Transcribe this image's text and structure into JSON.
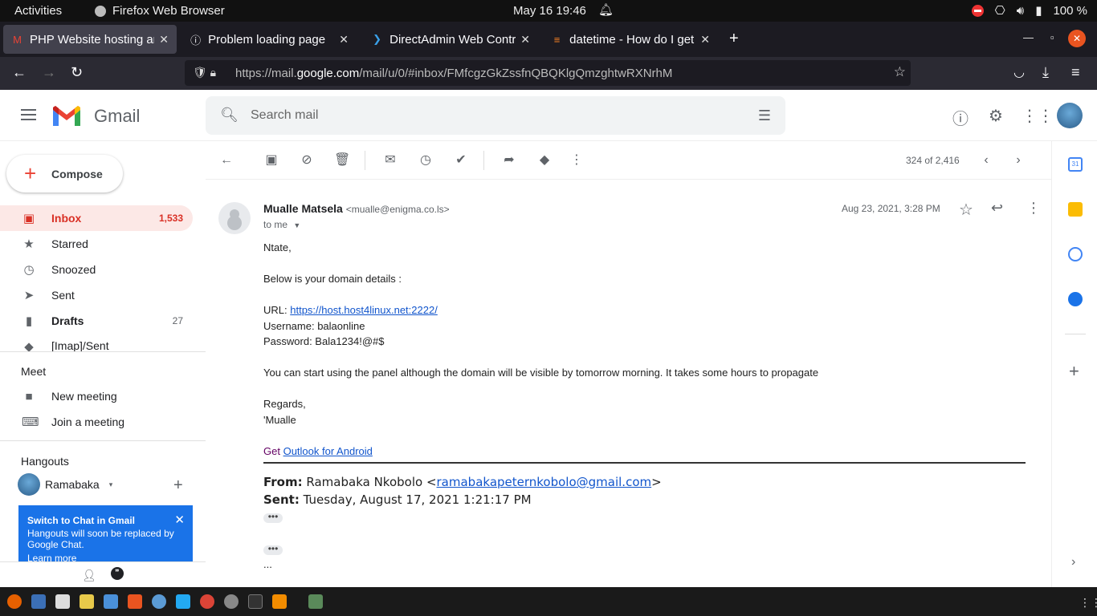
{
  "system": {
    "activities": "Activities",
    "app_name": "Firefox Web Browser",
    "datetime": "May 16  19:46",
    "battery": "100 %"
  },
  "browser": {
    "tabs": [
      {
        "label": "PHP Website hosting and",
        "active": true
      },
      {
        "label": "Problem loading page",
        "active": false
      },
      {
        "label": "DirectAdmin Web Contro",
        "active": false
      },
      {
        "label": "datetime - How do I get t",
        "active": false
      }
    ],
    "url_prefix": "https://mail.",
    "url_domain": "google.com",
    "url_path": "/mail/u/0/#inbox/FMfcgzGkZssfnQBQKlgQmzghtwRXNrhM"
  },
  "gmail": {
    "brand": "Gmail",
    "search_placeholder": "Search mail",
    "compose": "Compose",
    "nav": [
      {
        "label": "Inbox",
        "count": "1,533",
        "icon": "inbox-icon",
        "active": true
      },
      {
        "label": "Starred",
        "count": "",
        "icon": "star-icon"
      },
      {
        "label": "Snoozed",
        "count": "",
        "icon": "clock-icon"
      },
      {
        "label": "Sent",
        "count": "",
        "icon": "send-icon"
      },
      {
        "label": "Drafts",
        "count": "27",
        "icon": "draft-icon"
      },
      {
        "label": "[Imap]/Sent",
        "count": "",
        "icon": "label-icon"
      }
    ],
    "meet": {
      "title": "Meet",
      "new_meeting": "New meeting",
      "join_meeting": "Join a meeting"
    },
    "hangouts": {
      "title": "Hangouts",
      "user": "Ramabaka",
      "promo_title": "Switch to Chat in Gmail",
      "promo_text": "Hangouts will soon be replaced by Google Chat.",
      "promo_link": "Learn more"
    },
    "pager": "324 of 2,416"
  },
  "message": {
    "sender_name": "Mualle Matsela",
    "sender_email": "<mualle@enigma.co.ls>",
    "to": "to me",
    "date": "Aug 23, 2021, 3:28 PM",
    "greeting": "Ntate,",
    "intro": "Below is your domain details :",
    "url_label": "URL: ",
    "url": "https://host.host4linux.net:2222/",
    "username": "Username: balaonline",
    "password": "Password: Bala1234!@#$",
    "note": "You can start using the panel although the domain will be visible by tomorrow morning.  It takes some hours to propagate",
    "regards": "Regards,",
    "signature": "'Mualle",
    "get": "Get ",
    "outlook_link": "Outlook for Android",
    "from_label": "From:",
    "from_value": " Ramabaka Nkobolo <",
    "from_email": "ramabakapeternkobolo@gmail.com",
    "from_end": ">",
    "sent_label": "Sent:",
    "sent_value": " Tuesday, August 17, 2021 1:21:17 PM",
    "ellipsis_dots": "•••",
    "trailing": "..."
  }
}
